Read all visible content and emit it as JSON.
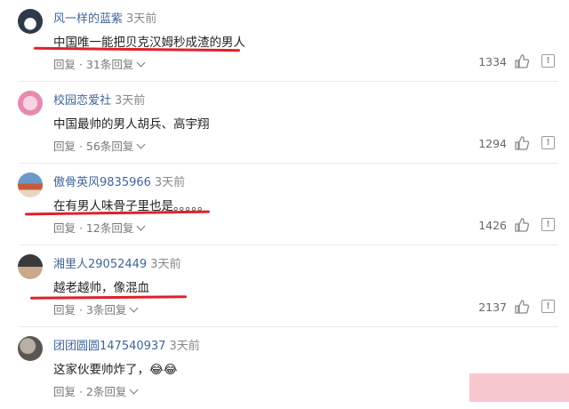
{
  "comments": [
    {
      "user": "风一样的蓝紫",
      "time": "3天前",
      "text": "中国唯一能把贝克汉姆秒成渣的男人",
      "reply": "回复 · 31条回复",
      "likes": "1334",
      "underline": true
    },
    {
      "user": "校园恋爱社",
      "time": "3天前",
      "text": "中国最帅的男人胡兵、高宇翔",
      "reply": "回复 · 56条回复",
      "likes": "1294",
      "underline": false
    },
    {
      "user": "傲骨英风9835966",
      "time": "3天前",
      "text": "在有男人味骨子里也是。。。。。",
      "reply": "回复 · 12条回复",
      "likes": "1426",
      "underline": true
    },
    {
      "user": "湘里人29052449",
      "time": "3天前",
      "text": "越老越帅，像混血",
      "reply": "回复 · 3条回复",
      "likes": "2137",
      "underline": true
    },
    {
      "user": "团团圆圆147540937",
      "time": "3天前",
      "text": "这家伙要帅炸了，😂😂",
      "reply": "回复 · 2条回复",
      "likes": "",
      "underline": false
    }
  ],
  "icons": {
    "like": "thumbs-up-icon",
    "report": "report-icon",
    "expand": "chevron-down-icon"
  },
  "colors": {
    "username": "#406599",
    "underline": "#e0202a"
  }
}
